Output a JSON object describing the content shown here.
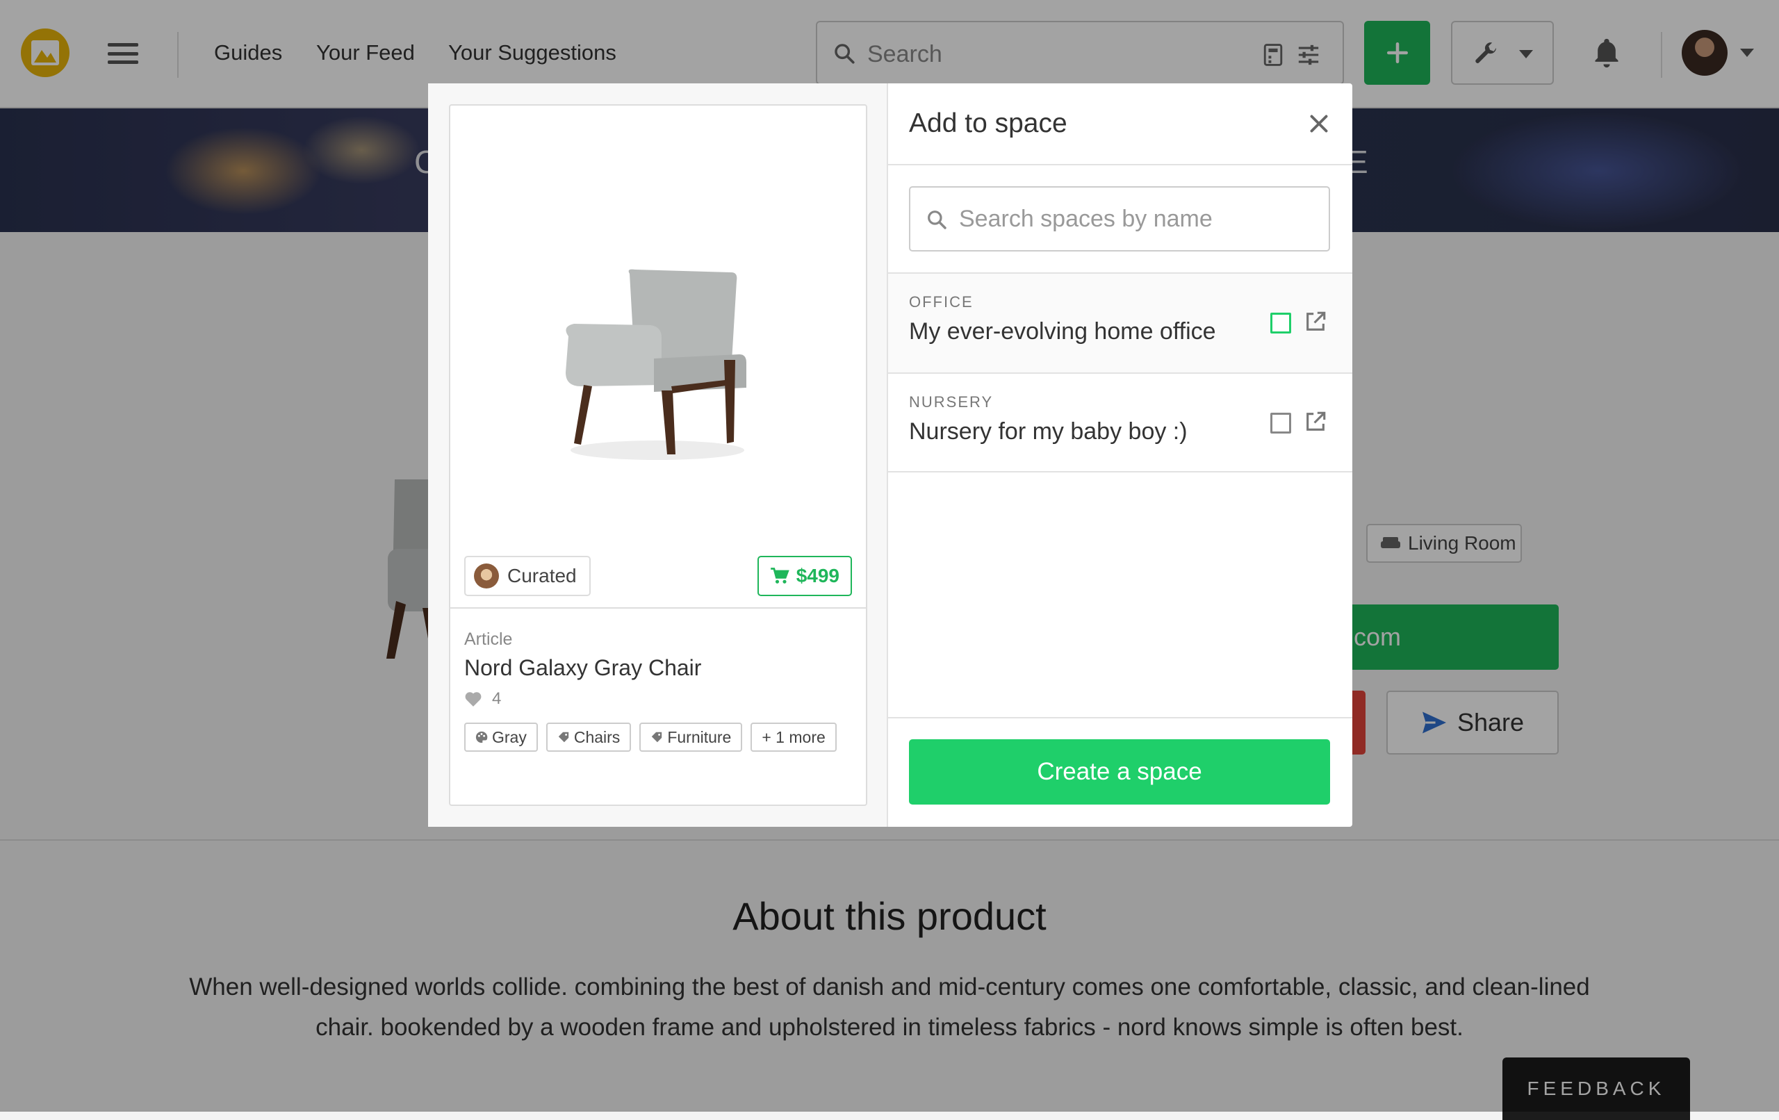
{
  "nav": {
    "links": [
      "Guides",
      "Your Feed",
      "Your Suggestions"
    ],
    "search_placeholder": "Search"
  },
  "banner": {
    "left_letter": "C",
    "right_letter": "E"
  },
  "product": {
    "room_tag": "Living Room",
    "shop_label": "e.com",
    "share_label": "Share"
  },
  "about": {
    "title": "About this product",
    "description": "When well-designed worlds collide. combining the best of danish and mid-century comes one comfortable, classic, and clean-lined chair. bookended by a wooden frame and upholstered in timeless fabrics - nord knows simple is often best."
  },
  "feedback_label": "FEEDBACK",
  "modal": {
    "card": {
      "curated_label": "Curated",
      "price": "$499",
      "brand": "Article",
      "name": "Nord Galaxy Gray Chair",
      "likes": "4",
      "tags": [
        "Gray",
        "Chairs",
        "Furniture"
      ],
      "more": "+ 1 more"
    },
    "title": "Add to space",
    "search_placeholder": "Search spaces by name",
    "spaces": [
      {
        "category": "OFFICE",
        "name": "My ever-evolving home office"
      },
      {
        "category": "NURSERY",
        "name": "Nursery for my baby boy :)"
      }
    ],
    "create_label": "Create a space"
  },
  "colors": {
    "accent_green": "#1fcf6a",
    "button_green": "#1fb65a",
    "logo_yellow": "#e8b40a",
    "share_red": "#e2443a"
  }
}
